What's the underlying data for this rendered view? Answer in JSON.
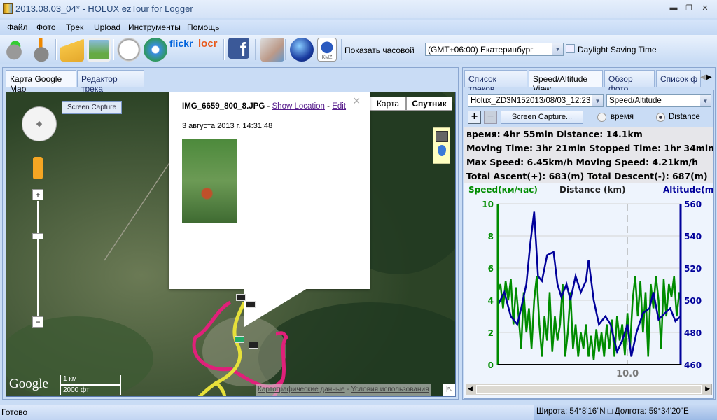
{
  "window": {
    "title": "2013.08.03_04* - HOLUX ezTour for Logger",
    "minimize": "▬",
    "restore": "❐",
    "close": "✕"
  },
  "menu": [
    "Файл",
    "Фото",
    "Трек",
    "Upload",
    "Инструменты",
    "Помощь"
  ],
  "toolbar": {
    "icons": [
      "import-gps-icon",
      "device-settings-icon",
      "open-photos-icon",
      "photo-album-icon",
      "clock-icon",
      "web-album-icon",
      "flickr-icon",
      "locr-icon",
      "facebook-icon",
      "export-icon",
      "google-earth-icon",
      "kmz-icon"
    ],
    "flickr": "flickr",
    "locr": "locr",
    "facebook": "f",
    "kmz": "KMZ",
    "timezone_label": "Показать часовой",
    "timezone_value": "(GMT+06:00) Екатеринбург",
    "dst_label": "Daylight Saving Time",
    "dst_checked": false
  },
  "left_tabs": [
    "Карта Google Map",
    "Редактор трека"
  ],
  "map": {
    "screen_capture": "Screen Capture",
    "map_type_map": "Карта",
    "map_type_satellite": "Спутник",
    "google": "Google",
    "scale_km": "1 км",
    "scale_ft": "2000 фт",
    "map_data": "Картографические данные",
    "terms": "Условия использования",
    "sep": " - ",
    "popup": {
      "filename": "IMG_6659_800_8.JPG",
      "show_location": "Show Location",
      "edit": "Edit",
      "dash": " - ",
      "date": "3 августа 2013 г. 14:31:48",
      "close": "×"
    }
  },
  "right_tabs": [
    "Список треков",
    "Speed/Altitude View",
    "Обзор фото",
    "Список ф"
  ],
  "track_select": "Holux_ZD3N152013/08/03_12:23",
  "view_select": "Speed/Altitude",
  "screen_capture_btn": "Screen Capture...",
  "radio_time": "время",
  "radio_distance": "Distance",
  "radio_selected": "distance",
  "stats": [
    "время: 4hr 55min  Distance: 14.1km",
    "Moving Time: 3hr 21min  Stopped Time: 1hr 34min",
    "Max Speed: 6.45km/h  Moving Speed: 4.21km/h",
    "Total Ascent(+): 683(m)  Total Descent(-): 687(m)"
  ],
  "chart_data": {
    "type": "line",
    "title_left": "Speed(км/час)",
    "title_center": "Distance (km)",
    "title_right": "Altitude(m)",
    "xlim": [
      0,
      14.1
    ],
    "x_ticks": [
      "10.0"
    ],
    "x_tick_values": [
      10
    ],
    "ylim_left": [
      0,
      10
    ],
    "y_ticks_left": [
      "0",
      "2",
      "4",
      "6",
      "8",
      "10"
    ],
    "ylim_right": [
      460,
      560
    ],
    "y_ticks_right": [
      "460",
      "480",
      "500",
      "520",
      "540",
      "560"
    ],
    "speed_color": "#008c00",
    "altitude_color": "#00009a",
    "series": [
      {
        "name": "Altitude",
        "x": [
          0,
          0.5,
          1,
          1.5,
          1.8,
          2.2,
          2.5,
          2.8,
          3.1,
          3.4,
          3.8,
          4.3,
          4.6,
          4.9,
          5.3,
          5.6,
          6.0,
          6.4,
          6.8,
          7.0,
          7.4,
          7.8,
          8.3,
          8.7,
          9.2,
          9.6,
          10.0,
          10.3,
          10.7,
          11.2,
          11.7,
          12.0,
          12.4,
          12.9,
          13.3,
          13.7,
          14.1
        ],
        "y": [
          497,
          505,
          490,
          485,
          495,
          510,
          535,
          555,
          515,
          512,
          528,
          530,
          510,
          502,
          510,
          500,
          515,
          505,
          512,
          525,
          500,
          485,
          490,
          485,
          468,
          475,
          485,
          465,
          480,
          492,
          495,
          505,
          488,
          492,
          495,
          487,
          490
        ]
      },
      {
        "name": "Speed",
        "x_step": 0.2,
        "y": [
          4.5,
          5.0,
          3.5,
          5.2,
          4.0,
          5.3,
          2.5,
          4.8,
          3.0,
          1.0,
          4.5,
          2.0,
          3.5,
          1.0,
          4.0,
          5.5,
          2.5,
          0.5,
          3.0,
          1.5,
          4.5,
          0.8,
          3.0,
          1.5,
          2.5,
          5.0,
          0.5,
          2.0,
          4.5,
          1.0,
          2.5,
          0.5,
          2.0,
          1.0,
          2.5,
          0.5,
          1.8,
          0.3,
          2.2,
          0.8,
          2.0,
          0.5,
          2.5,
          1.0,
          2.8,
          0.5,
          3.0,
          1.5,
          2.5,
          0.6,
          3.2,
          1.0,
          4.0,
          5.5,
          3.0,
          5.2,
          2.0,
          4.5,
          0.5,
          5.0,
          3.5,
          5.5,
          4.0,
          1.0,
          5.3,
          3.0,
          5.0,
          4.2,
          5.5,
          3.0,
          4.5
        ]
      }
    ]
  },
  "status": {
    "ready": "Готово",
    "coords": "Широта: 54°8'16\"N □ Долгота: 59°34'20\"E"
  }
}
